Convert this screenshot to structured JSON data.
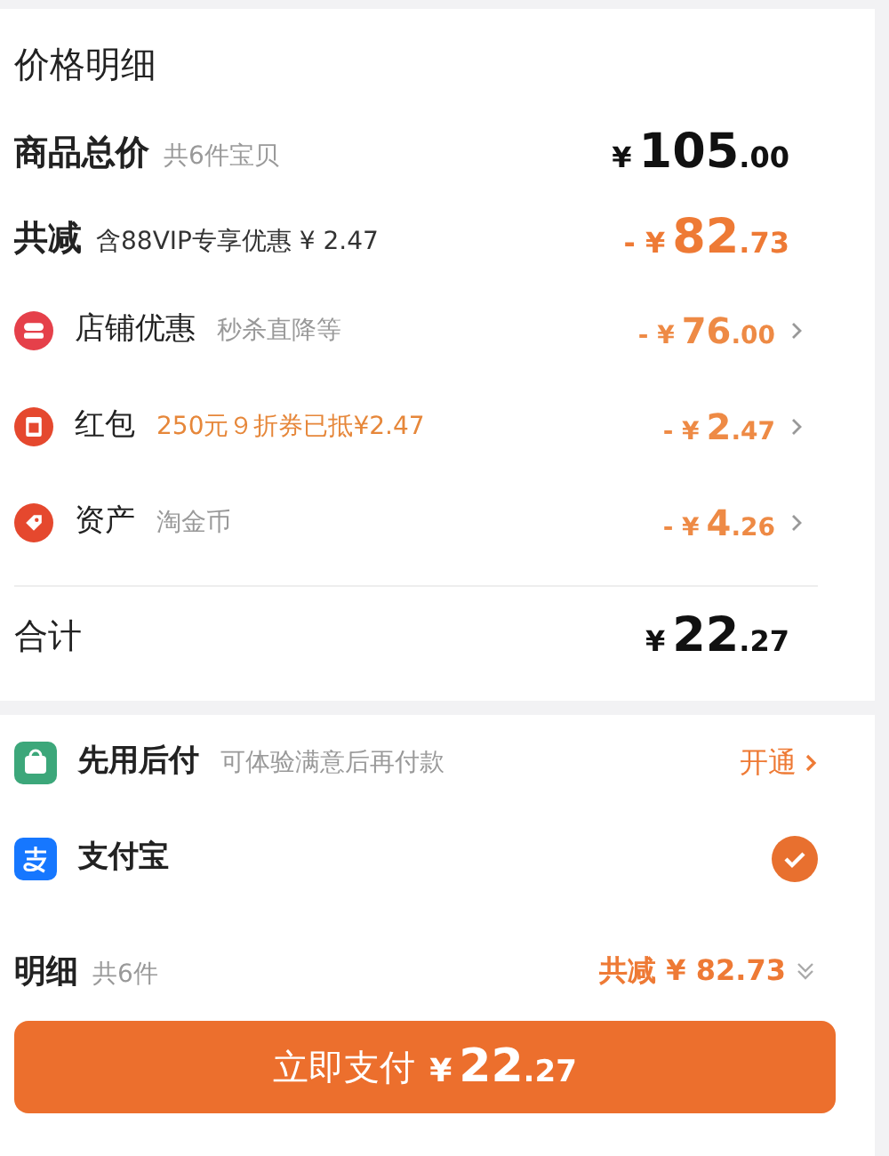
{
  "title": "价格明细",
  "total_goods": {
    "label": "商品总价",
    "note": "共6件宝贝",
    "amount": {
      "prefix": "¥",
      "integer": "105",
      "decimal": ".00"
    }
  },
  "total_discount": {
    "label": "共减",
    "note": "含88VIP专享优惠 ¥ 2.47",
    "amount": {
      "prefix": "- ¥",
      "integer": "82",
      "decimal": ".73"
    }
  },
  "discounts": [
    {
      "kind": "store",
      "label": "店铺优惠",
      "note": "秒杀直降等",
      "highlight": false,
      "amount": {
        "prefix": "- ¥",
        "integer": "76",
        "decimal": ".00"
      }
    },
    {
      "kind": "red-packet",
      "label": "红包",
      "note": "250元９折券已抵¥2.47",
      "highlight": true,
      "amount": {
        "prefix": "- ¥",
        "integer": "2",
        "decimal": ".47"
      }
    },
    {
      "kind": "coin",
      "label": "资产",
      "note": "淘金币",
      "highlight": false,
      "amount": {
        "prefix": "- ¥",
        "integer": "4",
        "decimal": ".26"
      }
    }
  ],
  "sum": {
    "label": "合计",
    "amount": {
      "prefix": "¥",
      "integer": "22",
      "decimal": ".27"
    }
  },
  "payment_methods": [
    {
      "kind": "pay-later",
      "label": "先用后付",
      "note": "可体验满意后再付款",
      "action": "开通",
      "selected": false
    },
    {
      "kind": "alipay",
      "label": "支付宝",
      "selected": true
    }
  ],
  "footer": {
    "label": "明细",
    "note": "共6件",
    "discount": "共减 ¥ 82.73"
  },
  "pay_button": {
    "label": "立即支付",
    "amount": {
      "prefix": "¥",
      "integer": "22",
      "decimal": ".27"
    }
  }
}
